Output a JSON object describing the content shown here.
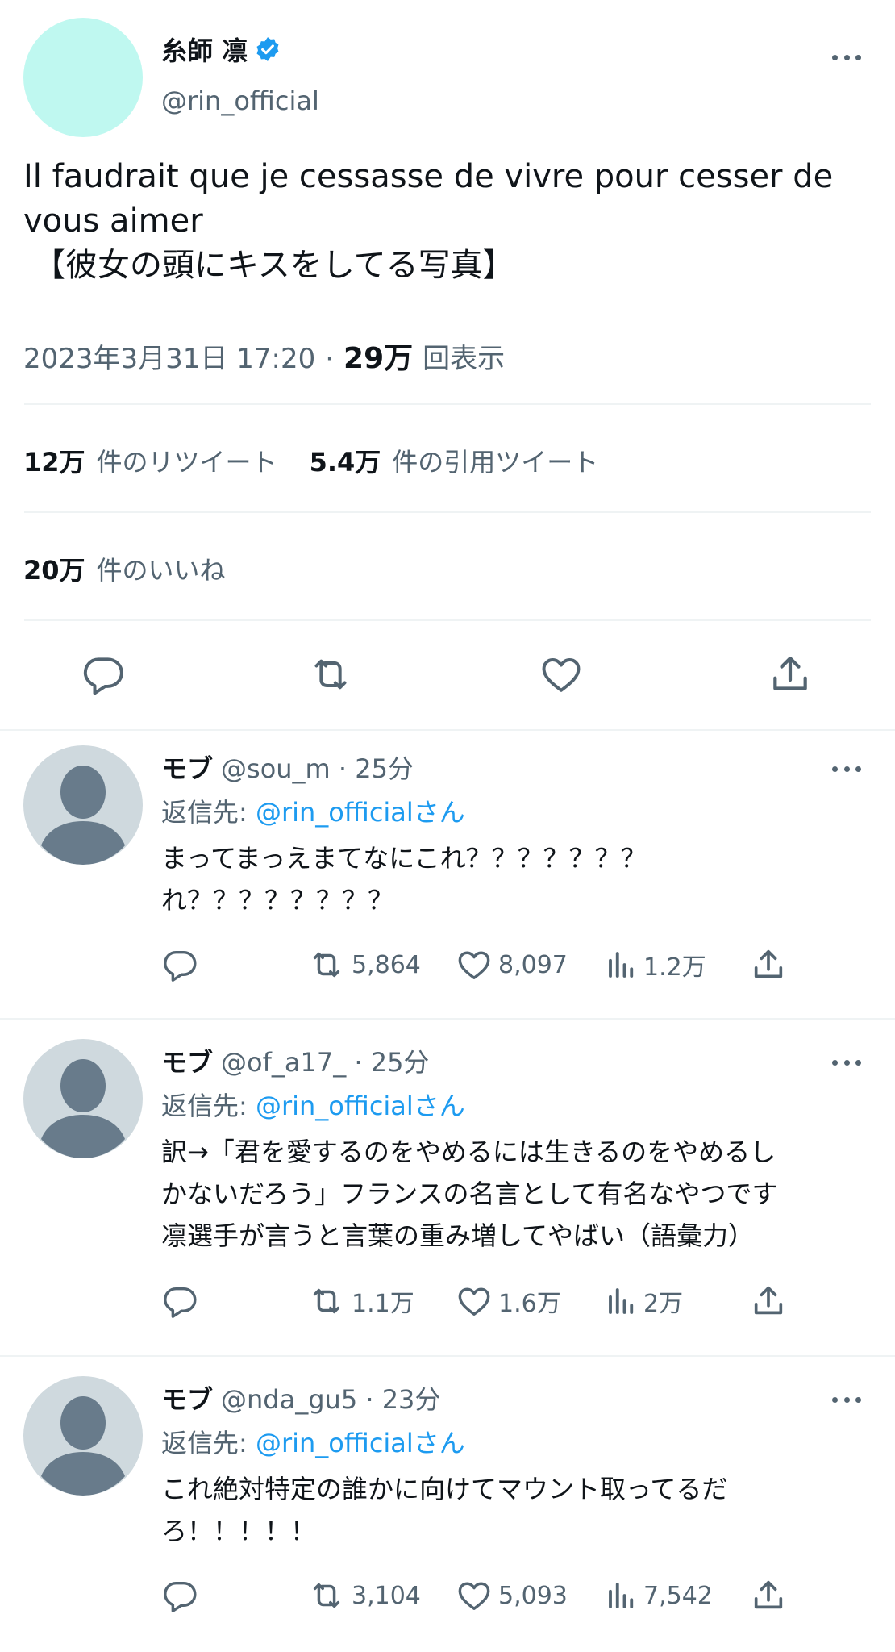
{
  "colors": {
    "accent": "#1d9bf0",
    "muted": "#536471",
    "avatar_main": "#bff8f0",
    "avatar_default_bg": "#cfd9de",
    "avatar_default_fg": "#687b8b"
  },
  "main_tweet": {
    "display_name": "糸師 凛",
    "handle": "@rin_official",
    "verified": true,
    "text_line1": "Il faudrait que je cessasse de vivre pour cesser de",
    "text_line2": "vous aimer",
    "text_line3": "【彼女の頭にキスをしてる写真】",
    "timestamp": "2023年3月31日 17:20",
    "dot": "·",
    "views": "29万",
    "views_label": "回表示",
    "retweets": "12万",
    "retweets_label": "件のリツイート",
    "quotes": "5.4万",
    "quotes_label": "件の引用ツイート",
    "likes": "20万",
    "likes_label": "件のいいね",
    "icons": [
      "reply-icon",
      "retweet-icon",
      "like-icon",
      "share-icon"
    ]
  },
  "replies": [
    {
      "name": "モブ",
      "handle_time": "@sou_m · 25分",
      "reply_prefix": "返信先:",
      "reply_to": "@rin_officialさん",
      "lines": [
        "まってまっえまてなにこれ？？？？？？？",
        "れ？？？？？？？？"
      ],
      "retweets": "5,864",
      "likes": "8,097",
      "views": "1.2万"
    },
    {
      "name": "モブ",
      "handle_time": "@of_a17_ · 25分",
      "reply_prefix": "返信先:",
      "reply_to": "@rin_officialさん",
      "lines": [
        "訳→「君を愛するのをやめるには生きるのをやめるし",
        "かないだろう」フランスの名言として有名なやつです",
        "凛選手が言うと言葉の重み増してやばい（語彙力）"
      ],
      "retweets": "1.1万",
      "likes": "1.6万",
      "views": "2万"
    },
    {
      "name": "モブ",
      "handle_time": "@nda_gu5 · 23分",
      "reply_prefix": "返信先:",
      "reply_to": "@rin_officialさん",
      "lines": [
        "これ絶対特定の誰かに向けてマウント取ってるだ",
        "ろ！！！！！"
      ],
      "retweets": "3,104",
      "likes": "5,093",
      "views": "7,542"
    }
  ]
}
